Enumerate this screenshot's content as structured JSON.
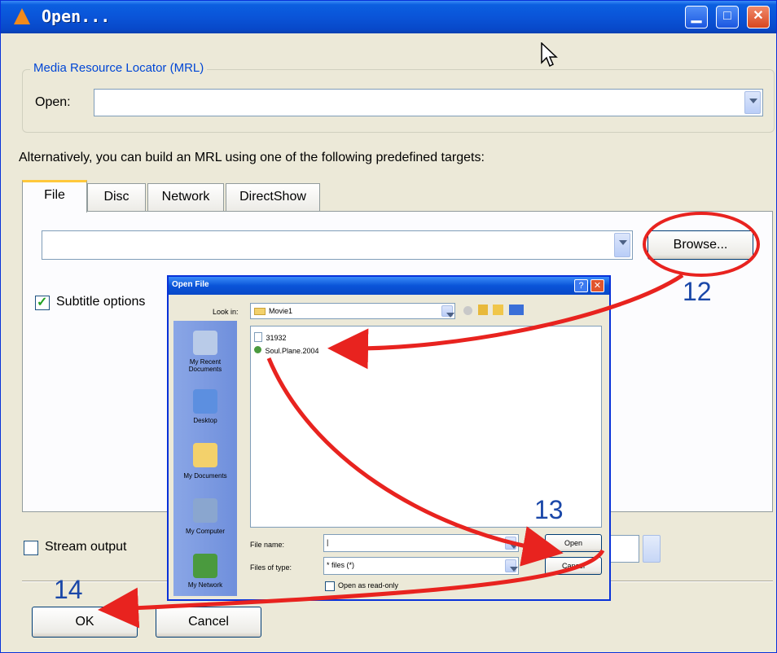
{
  "window": {
    "title": "Open..."
  },
  "mrl": {
    "legend": "Media Resource Locator (MRL)",
    "open_label": "Open:",
    "open_value": ""
  },
  "hint": "Alternatively, you can build an MRL using one of the following predefined targets:",
  "tabs": [
    {
      "label": "File"
    },
    {
      "label": "Disc"
    },
    {
      "label": "Network"
    },
    {
      "label": "DirectShow"
    }
  ],
  "file_tab": {
    "path_value": "",
    "browse_label": "Browse...",
    "subtitle_label": "Subtitle options"
  },
  "stream_output_label": "Stream output",
  "buttons": {
    "ok": "OK",
    "cancel": "Cancel"
  },
  "open_file_dialog": {
    "title": "Open File",
    "look_in_label": "Look in:",
    "look_in_value": "Movie1",
    "files": [
      "31932",
      "Soul.Plane.2004"
    ],
    "places": [
      "My Recent Documents",
      "Desktop",
      "My Documents",
      "My Computer",
      "My Network"
    ],
    "file_name_label": "File name:",
    "file_name_value": "|",
    "files_of_type_label": "Files of type:",
    "files_of_type_value": "* files (*)",
    "open_button": "Open",
    "cancel_button": "Cancel",
    "readonly_label": "Open as read-only"
  },
  "annotations": {
    "step12": "12",
    "step13": "13",
    "step14": "14"
  },
  "colors": {
    "titlebar": "#0a54d8",
    "arrow": "#e8231f",
    "annotation_number": "#1a47a8"
  }
}
